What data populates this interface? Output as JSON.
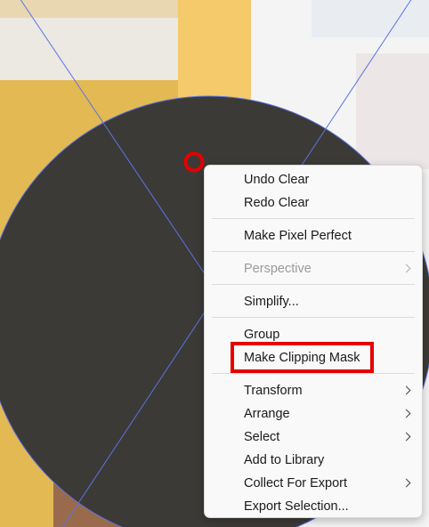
{
  "colors": {
    "shape_fill": "#3c3a37",
    "guide_line": "#5a74e0",
    "highlight": "#e60000",
    "background_yellow": "#f2c25a"
  },
  "canvas": {
    "shape": "circle",
    "click_marker": "red-ring-icon"
  },
  "context_menu": {
    "undo_clear": "Undo Clear",
    "redo_clear": "Redo Clear",
    "make_pixel_perfect": "Make Pixel Perfect",
    "perspective": "Perspective",
    "simplify": "Simplify...",
    "group": "Group",
    "make_clipping_mask": "Make Clipping Mask",
    "transform": "Transform",
    "arrange": "Arrange",
    "select": "Select",
    "add_to_library": "Add to Library",
    "collect_for_export": "Collect For Export",
    "export_selection": "Export Selection..."
  }
}
